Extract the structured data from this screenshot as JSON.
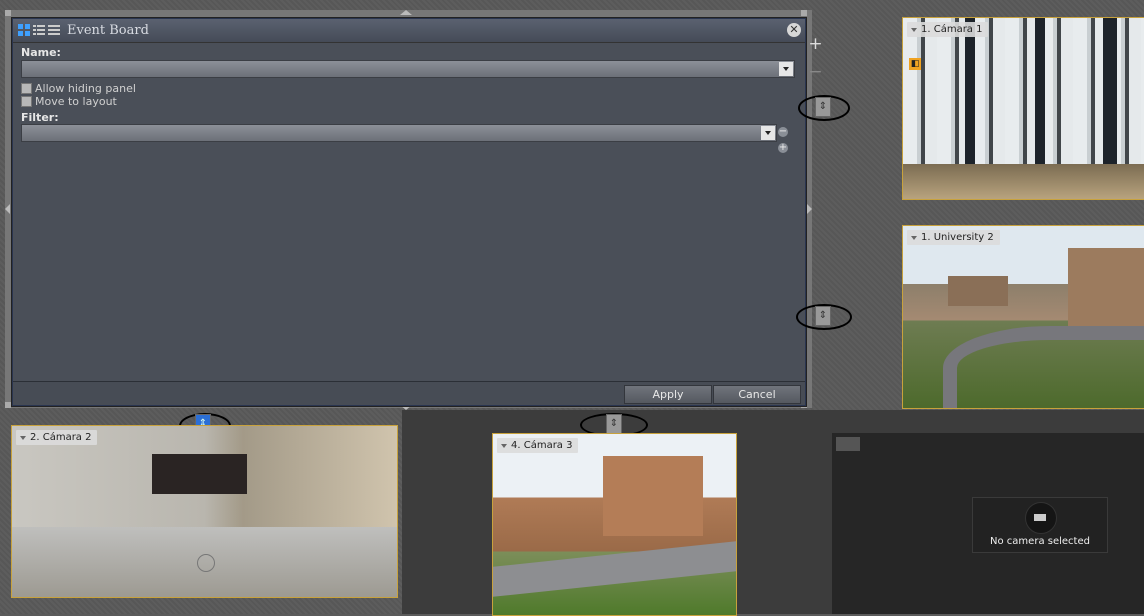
{
  "board": {
    "title": "Event Board",
    "name_label": "Name:",
    "name_value": "",
    "allow_hiding_label": "Allow hiding panel",
    "move_to_layout_label": "Move to layout",
    "filter_label": "Filter:",
    "filter_value": "",
    "apply_label": "Apply",
    "cancel_label": "Cancel",
    "close_glyph": "✕"
  },
  "side_tools": {
    "plus": "+",
    "minus": "−"
  },
  "filter_buttons": {
    "remove": "−",
    "add": "+"
  },
  "tiles": {
    "cam1": "1. Cámara 1",
    "univ2": "1. University 2",
    "cam2": "2. Cámara 2",
    "cam3": "4. Cámara 3"
  },
  "empty_tile": {
    "message": "No camera selected"
  },
  "icons": [
    "grid-view-icon",
    "list-view-icon",
    "details-view-icon",
    "close-icon",
    "dropdown-arrow-icon",
    "camera-icon",
    "event-icon",
    "drag-handle-icon"
  ],
  "colors": {
    "tile_border": "#c8a23c",
    "board_bg": "#4a4f58",
    "handle_active": "#2b6fd6"
  }
}
